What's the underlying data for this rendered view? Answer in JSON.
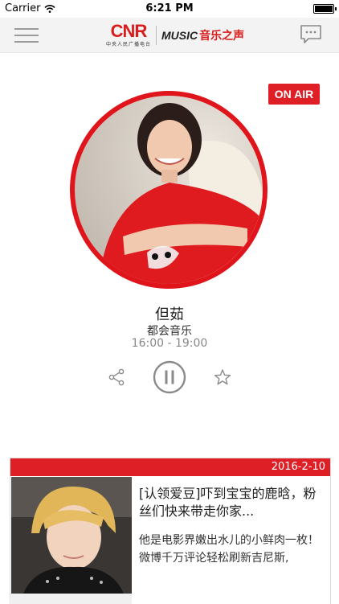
{
  "status_bar": {
    "carrier": "Carrier",
    "time": "6:21 PM"
  },
  "nav": {
    "logo_text": "CNR",
    "logo_sub": "中央人民广播电台",
    "channel_mark": "MUSIC",
    "channel_name": "音乐之声"
  },
  "live": {
    "badge": "ON AIR",
    "dj_name": "但茹",
    "show_name": "都会音乐",
    "show_time": "16:00 - 19:00"
  },
  "news_card": {
    "date": "2016-2-10",
    "title": "[认领爱豆]吓到宝宝的鹿晗，粉丝们快来带走你家...",
    "body": "他是电影界嫩出水儿的小鲜肉一枚！微博千万评论轻松刷新吉尼斯,"
  },
  "colors": {
    "brand_red": "#de1f26",
    "nav_bg": "#f3f3f3"
  },
  "icons": [
    "wifi-icon",
    "battery-icon",
    "menu-icon",
    "chat-icon",
    "share-icon",
    "pause-icon",
    "star-icon"
  ]
}
